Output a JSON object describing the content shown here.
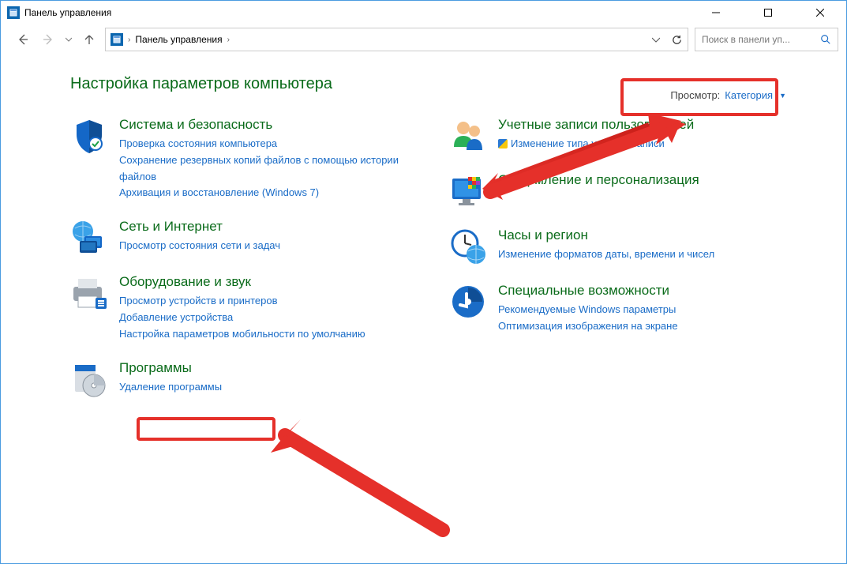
{
  "window": {
    "title": "Панель управления",
    "min_label": "Minimize",
    "max_label": "Maximize",
    "close_label": "Close"
  },
  "nav": {
    "back_label": "Назад",
    "forward_label": "Вперёд",
    "up_label": "Вверх",
    "refresh_label": "Обновить"
  },
  "breadcrumb": {
    "root": "Панель управления",
    "sep": "›"
  },
  "search": {
    "placeholder": "Поиск в панели уп..."
  },
  "heading": "Настройка параметров компьютера",
  "viewby": {
    "label": "Просмотр:",
    "value": "Категория"
  },
  "categories_left": [
    {
      "icon": "shield-icon",
      "title": "Система и безопасность",
      "subs": [
        {
          "text": "Проверка состояния компьютера",
          "shield": false
        },
        {
          "text": "Сохранение резервных копий файлов с помощью истории файлов",
          "shield": false
        },
        {
          "text": "Архивация и восстановление (Windows 7)",
          "shield": false
        }
      ]
    },
    {
      "icon": "globe-network-icon",
      "title": "Сеть и Интернет",
      "subs": [
        {
          "text": "Просмотр состояния сети и задач",
          "shield": false
        }
      ]
    },
    {
      "icon": "printer-icon",
      "title": "Оборудование и звук",
      "subs": [
        {
          "text": "Просмотр устройств и принтеров",
          "shield": false
        },
        {
          "text": "Добавление устройства",
          "shield": false
        },
        {
          "text": "Настройка параметров мобильности по умолчанию",
          "shield": false
        }
      ]
    },
    {
      "icon": "disc-box-icon",
      "title": "Программы",
      "subs": [
        {
          "text": "Удаление программы",
          "shield": false
        }
      ]
    }
  ],
  "categories_right": [
    {
      "icon": "users-icon",
      "title": "Учетные записи пользователей",
      "subs": [
        {
          "text": "Изменение типа учетной записи",
          "shield": true
        }
      ]
    },
    {
      "icon": "personalization-icon",
      "title": "Оформление и персонализация",
      "subs": []
    },
    {
      "icon": "clock-globe-icon",
      "title": "Часы и регион",
      "subs": [
        {
          "text": "Изменение форматов даты, времени и чисел",
          "shield": false
        }
      ]
    },
    {
      "icon": "accessibility-icon",
      "title": "Специальные возможности",
      "subs": [
        {
          "text": "Рекомендуемые Windows параметры",
          "shield": false
        },
        {
          "text": "Оптимизация изображения на экране",
          "shield": false
        }
      ]
    }
  ]
}
